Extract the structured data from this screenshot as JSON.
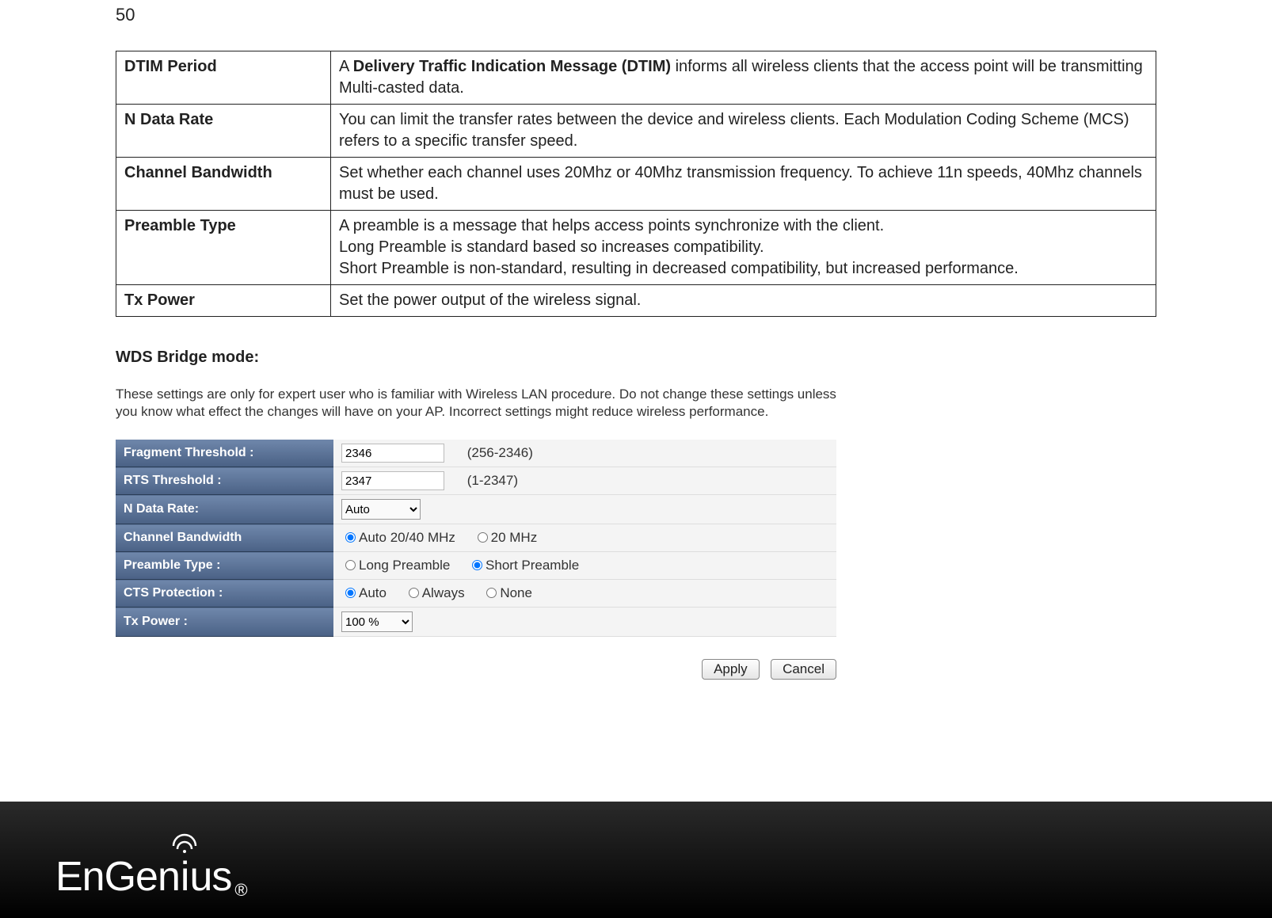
{
  "page_number": "50",
  "definitions": [
    {
      "term": "DTIM Period",
      "desc_prefix": "A ",
      "desc_bold": "Delivery Traffic Indication Message (DTIM)",
      "desc_suffix": " informs all wireless clients that the access point will be transmitting Multi-casted data."
    },
    {
      "term": "N Data Rate",
      "lines": [
        "You can limit the transfer rates between the device and wireless clients. Each Modulation Coding Scheme (MCS) refers to a specific transfer speed."
      ]
    },
    {
      "term": "Channel Bandwidth",
      "lines": [
        "Set whether each channel uses 20Mhz or 40Mhz transmission frequency. To achieve 11n speeds, 40Mhz channels must be used."
      ]
    },
    {
      "term": "Preamble Type",
      "lines": [
        "A preamble is a message that helps access points synchronize with the client.",
        "Long Preamble is standard based so increases compatibility.",
        "Short Preamble is non-standard, resulting in decreased compatibility, but increased performance."
      ]
    },
    {
      "term": "Tx Power",
      "lines": [
        "Set the power output of the wireless signal."
      ]
    }
  ],
  "section_heading": "WDS Bridge mode:",
  "wds_note": "These settings are only for expert user who is familiar with Wireless LAN procedure. Do not change these settings unless you know what effect the changes will have on your AP. Incorrect settings might reduce wireless performance.",
  "form": {
    "fragment_label": "Fragment Threshold :",
    "fragment_value": "2346",
    "fragment_range": "(256-2346)",
    "rts_label": "RTS Threshold :",
    "rts_value": "2347",
    "rts_range": "(1-2347)",
    "ndatarate_label": "N Data Rate:",
    "ndatarate_value": "Auto",
    "chbw_label": "Channel Bandwidth",
    "chbw_opt1": "Auto 20/40 MHz",
    "chbw_opt2": "20 MHz",
    "preamble_label": "Preamble Type :",
    "preamble_opt1": "Long Preamble",
    "preamble_opt2": "Short Preamble",
    "cts_label": "CTS Protection :",
    "cts_opt1": "Auto",
    "cts_opt2": "Always",
    "cts_opt3": "None",
    "txpower_label": "Tx Power :",
    "txpower_value": "100 %"
  },
  "buttons": {
    "apply": "Apply",
    "cancel": "Cancel"
  },
  "logo": {
    "part1": "EnGen",
    "part2": "i",
    "part3": "us",
    "reg": "®"
  }
}
